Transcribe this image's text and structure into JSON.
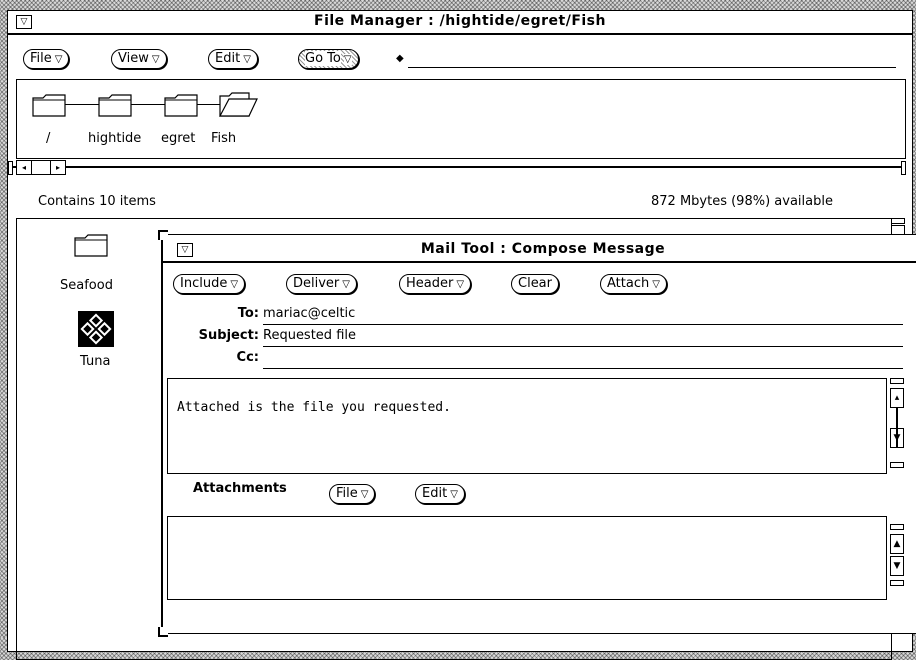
{
  "file_manager": {
    "title": "File Manager : /hightide/egret/Fish",
    "menus": [
      {
        "label": "File"
      },
      {
        "label": "View"
      },
      {
        "label": "Edit"
      },
      {
        "label": "Go To"
      }
    ],
    "path": [
      "/",
      "hightide",
      "egret",
      "Fish"
    ],
    "status_left": "Contains 10 items",
    "status_right": "872 Mbytes (98%) available",
    "items": [
      {
        "label": "Seafood",
        "icon": "folder-icon"
      },
      {
        "label": "Tuna",
        "icon": "sun-logo-icon"
      }
    ]
  },
  "mail_tool": {
    "title": "Mail Tool : Compose Message",
    "buttons": [
      {
        "label": "Include"
      },
      {
        "label": "Deliver"
      },
      {
        "label": "Header"
      },
      {
        "label": "Clear"
      },
      {
        "label": "Attach"
      }
    ],
    "to_label": "To:",
    "to_value": "mariac@celtic",
    "subject_label": "Subject:",
    "subject_value": "Requested file",
    "cc_label": "Cc:",
    "cc_value": "",
    "body": "Attached is the file you requested.",
    "attachments_label": "Attachments",
    "attachments_buttons": [
      {
        "label": "File"
      },
      {
        "label": "Edit"
      }
    ]
  }
}
